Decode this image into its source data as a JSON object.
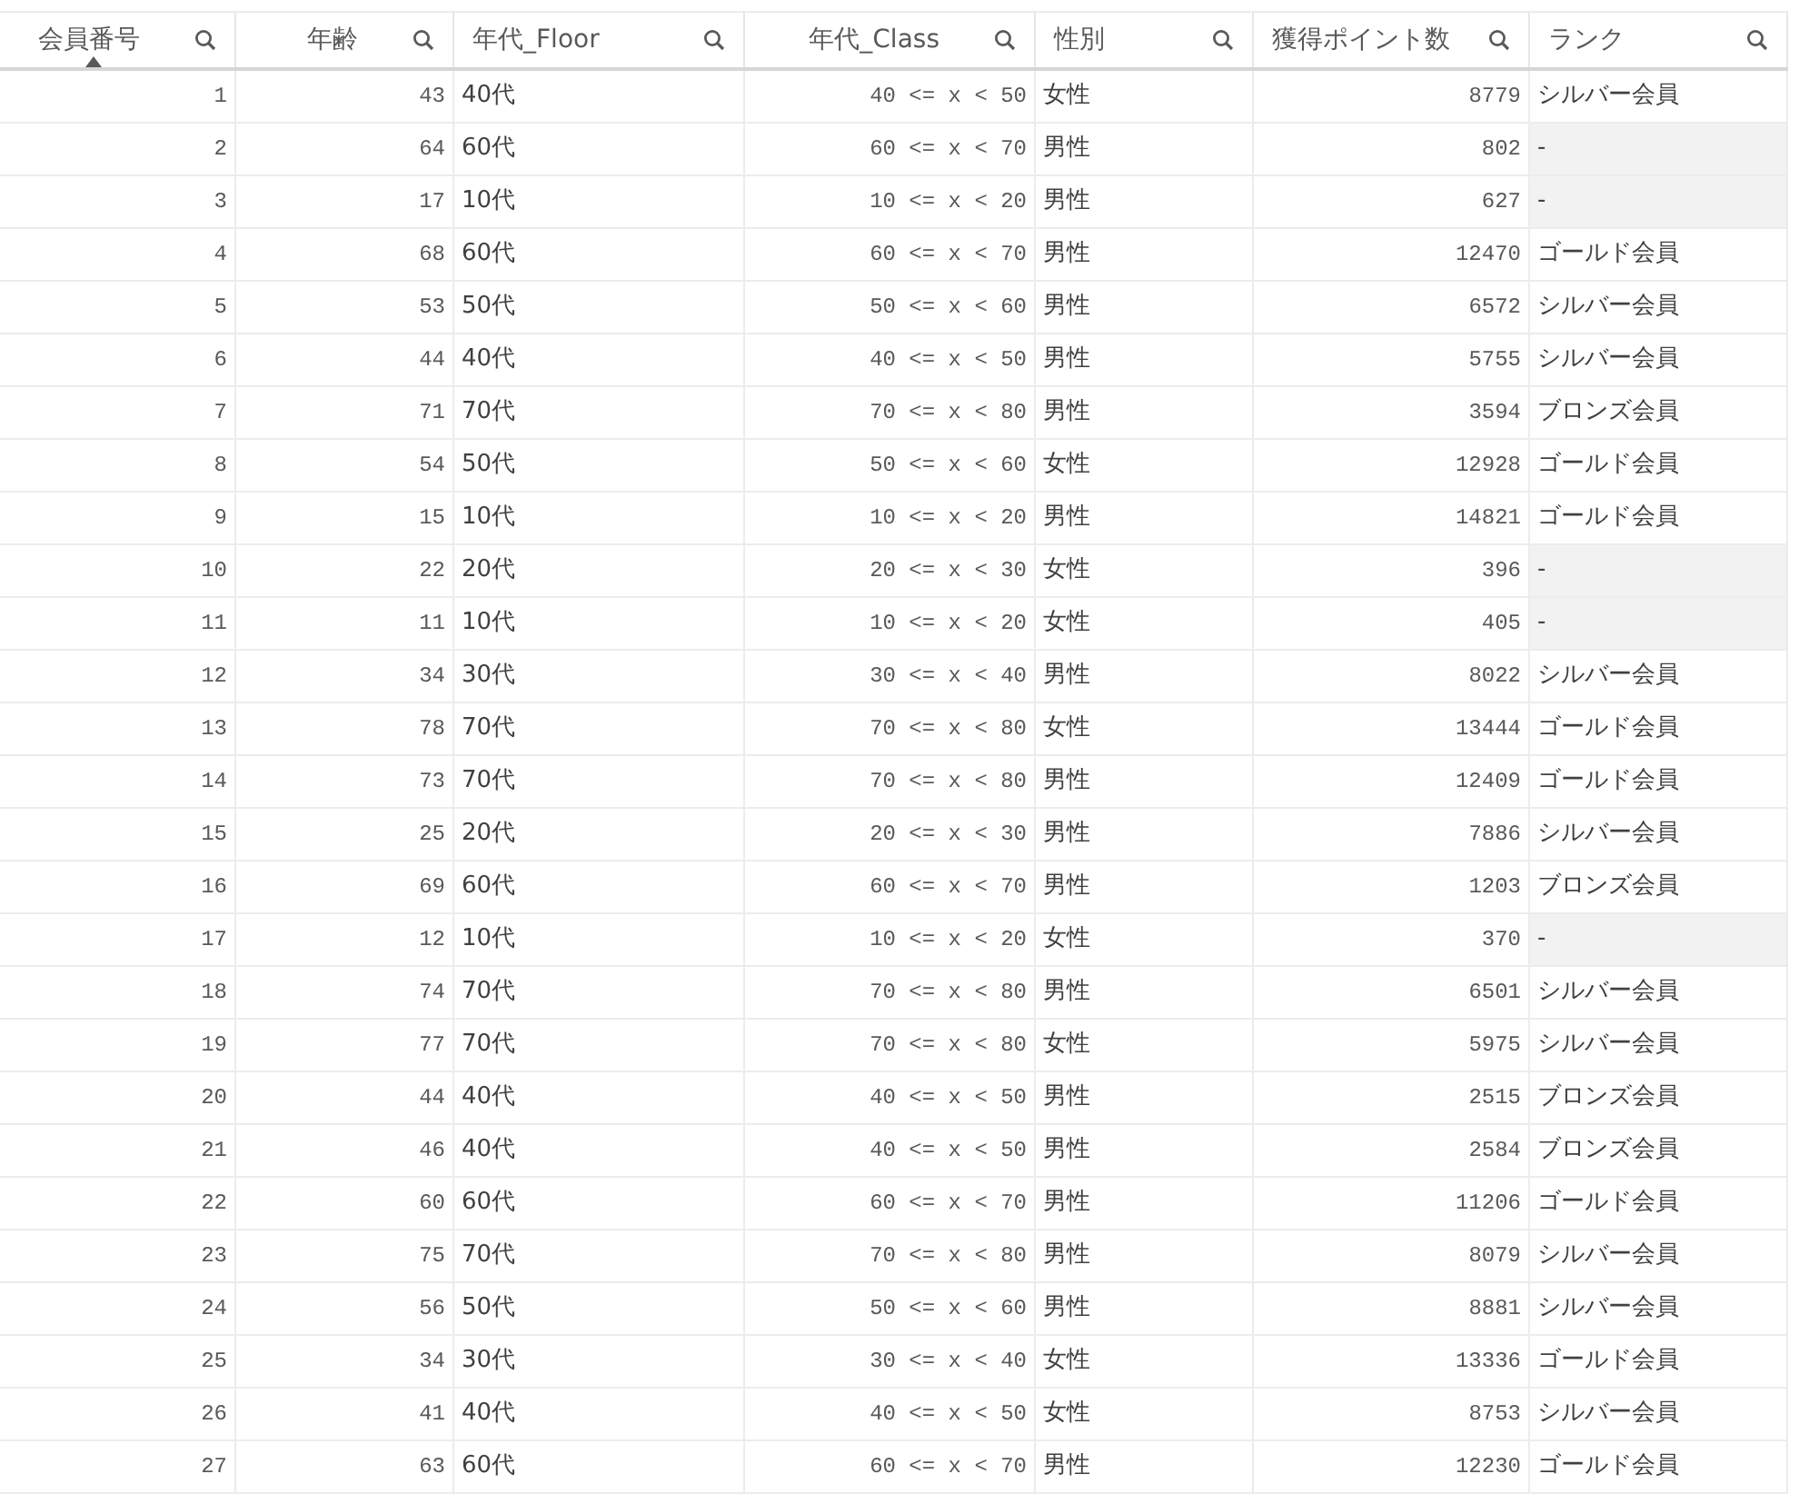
{
  "table": {
    "columns": [
      {
        "label": "会員番号",
        "kind": "number",
        "sorted": true
      },
      {
        "label": "年齢",
        "kind": "number",
        "sorted": false
      },
      {
        "label": "年代_Floor",
        "kind": "text",
        "sorted": false
      },
      {
        "label": "年代_Class",
        "kind": "range",
        "sorted": false
      },
      {
        "label": "性別",
        "kind": "text",
        "sorted": false
      },
      {
        "label": "獲得ポイント数",
        "kind": "number",
        "sorted": false
      },
      {
        "label": "ランク",
        "kind": "text",
        "sorted": false
      }
    ],
    "rows": [
      {
        "cells": [
          "1",
          "43",
          "40代",
          "40 <= x < 50",
          "女性",
          "8779",
          "シルバー会員"
        ],
        "rank_null": false
      },
      {
        "cells": [
          "2",
          "64",
          "60代",
          "60 <= x < 70",
          "男性",
          "802",
          "-"
        ],
        "rank_null": true
      },
      {
        "cells": [
          "3",
          "17",
          "10代",
          "10 <= x < 20",
          "男性",
          "627",
          "-"
        ],
        "rank_null": true
      },
      {
        "cells": [
          "4",
          "68",
          "60代",
          "60 <= x < 70",
          "男性",
          "12470",
          "ゴールド会員"
        ],
        "rank_null": false
      },
      {
        "cells": [
          "5",
          "53",
          "50代",
          "50 <= x < 60",
          "男性",
          "6572",
          "シルバー会員"
        ],
        "rank_null": false
      },
      {
        "cells": [
          "6",
          "44",
          "40代",
          "40 <= x < 50",
          "男性",
          "5755",
          "シルバー会員"
        ],
        "rank_null": false
      },
      {
        "cells": [
          "7",
          "71",
          "70代",
          "70 <= x < 80",
          "男性",
          "3594",
          "ブロンズ会員"
        ],
        "rank_null": false
      },
      {
        "cells": [
          "8",
          "54",
          "50代",
          "50 <= x < 60",
          "女性",
          "12928",
          "ゴールド会員"
        ],
        "rank_null": false
      },
      {
        "cells": [
          "9",
          "15",
          "10代",
          "10 <= x < 20",
          "男性",
          "14821",
          "ゴールド会員"
        ],
        "rank_null": false
      },
      {
        "cells": [
          "10",
          "22",
          "20代",
          "20 <= x < 30",
          "女性",
          "396",
          "-"
        ],
        "rank_null": true
      },
      {
        "cells": [
          "11",
          "11",
          "10代",
          "10 <= x < 20",
          "女性",
          "405",
          "-"
        ],
        "rank_null": true
      },
      {
        "cells": [
          "12",
          "34",
          "30代",
          "30 <= x < 40",
          "男性",
          "8022",
          "シルバー会員"
        ],
        "rank_null": false
      },
      {
        "cells": [
          "13",
          "78",
          "70代",
          "70 <= x < 80",
          "女性",
          "13444",
          "ゴールド会員"
        ],
        "rank_null": false
      },
      {
        "cells": [
          "14",
          "73",
          "70代",
          "70 <= x < 80",
          "男性",
          "12409",
          "ゴールド会員"
        ],
        "rank_null": false
      },
      {
        "cells": [
          "15",
          "25",
          "20代",
          "20 <= x < 30",
          "男性",
          "7886",
          "シルバー会員"
        ],
        "rank_null": false
      },
      {
        "cells": [
          "16",
          "69",
          "60代",
          "60 <= x < 70",
          "男性",
          "1203",
          "ブロンズ会員"
        ],
        "rank_null": false
      },
      {
        "cells": [
          "17",
          "12",
          "10代",
          "10 <= x < 20",
          "女性",
          "370",
          "-"
        ],
        "rank_null": true
      },
      {
        "cells": [
          "18",
          "74",
          "70代",
          "70 <= x < 80",
          "男性",
          "6501",
          "シルバー会員"
        ],
        "rank_null": false
      },
      {
        "cells": [
          "19",
          "77",
          "70代",
          "70 <= x < 80",
          "女性",
          "5975",
          "シルバー会員"
        ],
        "rank_null": false
      },
      {
        "cells": [
          "20",
          "44",
          "40代",
          "40 <= x < 50",
          "男性",
          "2515",
          "ブロンズ会員"
        ],
        "rank_null": false
      },
      {
        "cells": [
          "21",
          "46",
          "40代",
          "40 <= x < 50",
          "男性",
          "2584",
          "ブロンズ会員"
        ],
        "rank_null": false
      },
      {
        "cells": [
          "22",
          "60",
          "60代",
          "60 <= x < 70",
          "男性",
          "11206",
          "ゴールド会員"
        ],
        "rank_null": false
      },
      {
        "cells": [
          "23",
          "75",
          "70代",
          "70 <= x < 80",
          "男性",
          "8079",
          "シルバー会員"
        ],
        "rank_null": false
      },
      {
        "cells": [
          "24",
          "56",
          "50代",
          "50 <= x < 60",
          "男性",
          "8881",
          "シルバー会員"
        ],
        "rank_null": false
      },
      {
        "cells": [
          "25",
          "34",
          "30代",
          "30 <= x < 40",
          "女性",
          "13336",
          "ゴールド会員"
        ],
        "rank_null": false
      },
      {
        "cells": [
          "26",
          "41",
          "40代",
          "40 <= x < 50",
          "女性",
          "8753",
          "シルバー会員"
        ],
        "rank_null": false
      },
      {
        "cells": [
          "27",
          "63",
          "60代",
          "60 <= x < 70",
          "男性",
          "12230",
          "ゴールド会員"
        ],
        "rank_null": false
      }
    ]
  }
}
